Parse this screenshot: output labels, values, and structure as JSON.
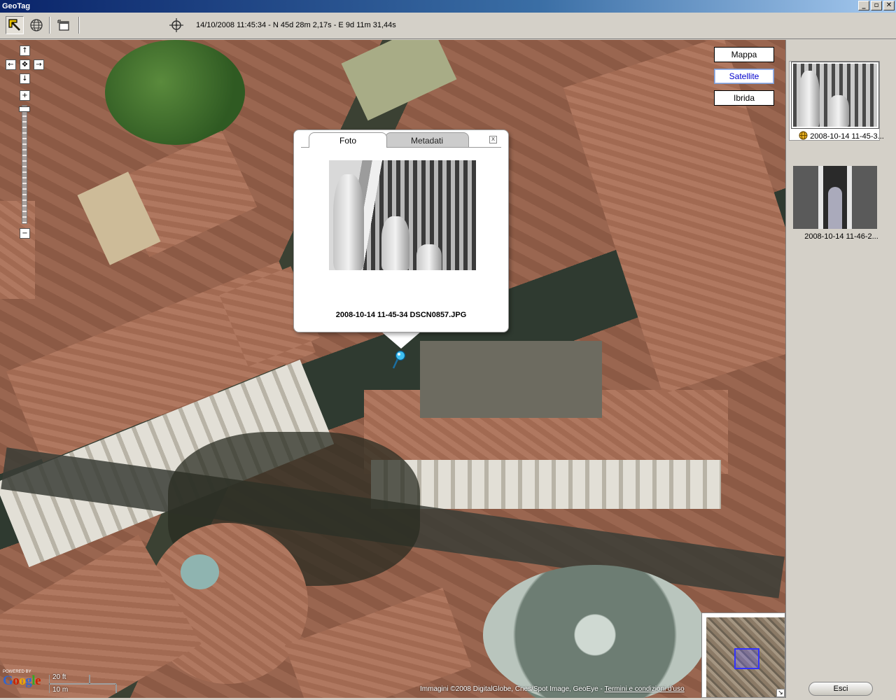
{
  "window": {
    "title": "GeoTag",
    "minimize": "_",
    "maximize": "▫",
    "close": "✕"
  },
  "toolbar": {
    "tools": [
      {
        "name": "pointer-tool",
        "icon": "arrow-cursor-icon",
        "active": true
      },
      {
        "name": "globe-tool",
        "icon": "globe-icon",
        "active": false
      },
      {
        "name": "window-tool",
        "icon": "window-icon",
        "active": false
      },
      {
        "name": "locate-tool",
        "icon": "crosshair-icon",
        "active": false
      }
    ],
    "coords": "14/10/2008 11:45:34 - N 45d 28m 2,17s - E 9d 11m 31,44s"
  },
  "map": {
    "types": [
      {
        "label": "Mappa",
        "selected": false
      },
      {
        "label": "Satellite",
        "selected": true
      },
      {
        "label": "Ibrida",
        "selected": false
      }
    ],
    "nav": {
      "up": "↑",
      "down": "↓",
      "left": "←",
      "right": "→",
      "center": "✥",
      "zoom_in": "+",
      "zoom_out": "−"
    },
    "powered_by": "POWERED BY",
    "logo": {
      "letters": [
        "G",
        "o",
        "o",
        "g",
        "l",
        "e"
      ],
      "colors": [
        "#3366cc",
        "#cc2200",
        "#eeaa00",
        "#3366cc",
        "#33aa22",
        "#cc2200"
      ]
    },
    "scale": {
      "feet": "20 ft",
      "meters": "10 m"
    },
    "copyright": "Immagini ©2008 DigitalGlobe, Cnes/Spot Image, GeoEye - ",
    "terms": "Termini e condizioni d'uso",
    "overview_toggle": "↘"
  },
  "infowindow": {
    "tabs": [
      {
        "label": "Foto",
        "active": true
      },
      {
        "label": "Metadati",
        "active": false
      }
    ],
    "close": "x",
    "caption": "2008-10-14 11-45-34 DSCN0857.JPG"
  },
  "panel": {
    "thumbnails": [
      {
        "caption": "2008-10-14 11-45-3...",
        "geotagged": true,
        "selected": true
      },
      {
        "caption": "2008-10-14 11-46-2...",
        "geotagged": false,
        "selected": false
      }
    ],
    "exit_label": "Esci"
  }
}
